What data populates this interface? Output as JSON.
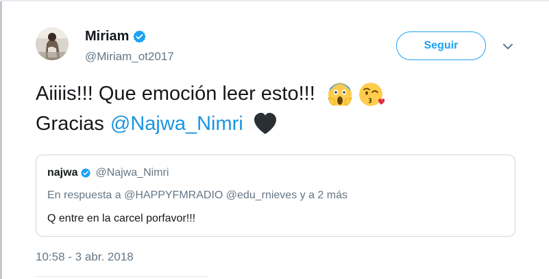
{
  "tweet": {
    "author": {
      "display_name": "Miriam",
      "handle": "@Miriam_ot2017",
      "verified": true
    },
    "follow_button_label": "Seguir",
    "text": {
      "line1": "Aiiiis!!! Que emoción leer esto!!!",
      "line1_emojis": [
        "screaming-face-emoji",
        "face-blowing-kiss-emoji"
      ],
      "line2_prefix": "Gracias",
      "line2_mention": "@Najwa_Nimri",
      "line2_emoji": "black-heart-emoji"
    },
    "quoted_tweet": {
      "display_name": "najwa",
      "handle": "@Najwa_Nimri",
      "verified": true,
      "reply_context": "En respuesta a @HAPPYFMRADIO @edu_rnieves y a 2 más",
      "text": "Q entre en la carcel porfavor!!!"
    },
    "timestamp": "10:58 - 3 abr. 2018"
  },
  "colors": {
    "accent": "#1da1f2",
    "mention": "#1b95e0",
    "secondary_text": "#657786",
    "primary_text": "#14171a",
    "border": "#ccd6dd"
  }
}
